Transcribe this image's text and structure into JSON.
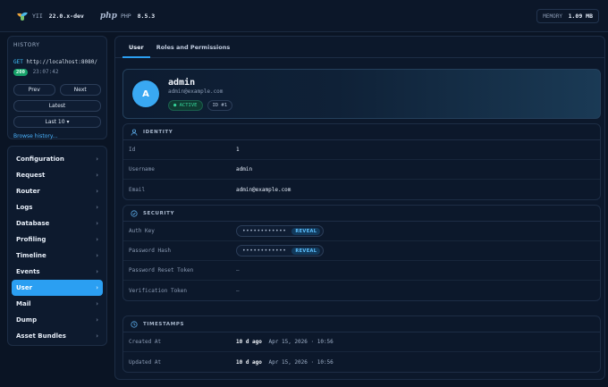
{
  "topbar": {
    "framework_label": "YII",
    "framework_version": "22.0.x-dev",
    "php_logo": "php",
    "php_label": "PHP",
    "php_version": "8.5.3",
    "memory_label": "MEMORY",
    "memory_value": "1.09 MB"
  },
  "history": {
    "title": "HISTORY",
    "method": "GET",
    "url": "http://localhost:8080/",
    "status": "200",
    "time": "23:07:42",
    "prev_label": "Prev",
    "next_label": "Next",
    "latest_label": "Latest",
    "last_label": "Last 10 ▾",
    "browse_label": "Browse history..."
  },
  "nav": {
    "items": [
      {
        "label": "Configuration"
      },
      {
        "label": "Request"
      },
      {
        "label": "Router"
      },
      {
        "label": "Logs"
      },
      {
        "label": "Database"
      },
      {
        "label": "Profiling"
      },
      {
        "label": "Timeline"
      },
      {
        "label": "Events"
      },
      {
        "label": "User",
        "active": true
      },
      {
        "label": "Mail"
      },
      {
        "label": "Dump"
      },
      {
        "label": "Asset Bundles"
      }
    ],
    "chevron": "›"
  },
  "tabs": [
    {
      "label": "User",
      "active": true
    },
    {
      "label": "Roles and Permissions"
    }
  ],
  "profile": {
    "initial": "A",
    "name": "admin",
    "email": "admin@example.com",
    "status_badge": "● ACTIVE",
    "id_badge": "ID #1"
  },
  "identity": {
    "title": "IDENTITY",
    "rows": [
      {
        "label": "Id",
        "value": "1"
      },
      {
        "label": "Username",
        "value": "admin"
      },
      {
        "label": "Email",
        "value": "admin@example.com"
      }
    ]
  },
  "security": {
    "title": "SECURITY",
    "auth_key_label": "Auth Key",
    "auth_key_mask": "••••••••••••",
    "password_hash_label": "Password Hash",
    "password_hash_mask": "••••••••••••",
    "reveal_label": "REVEAL",
    "reset_token_label": "Password Reset Token",
    "reset_token_value": "—",
    "verification_token_label": "Verification Token",
    "verification_token_value": "—"
  },
  "timestamps": {
    "title": "TIMESTAMPS",
    "rows": [
      {
        "label": "Created At",
        "ago": "10 d ago",
        "date": "Apr 15, 2026 · 10:56"
      },
      {
        "label": "Updated At",
        "ago": "10 d ago",
        "date": "Apr 15, 2026 · 10:56"
      }
    ]
  },
  "colors": {
    "accent": "#2b9ff2",
    "background": "#0a1424",
    "success": "#35d49a"
  },
  "icons": {
    "logo": "yii-logo-icon",
    "identity": "user-icon",
    "security": "shield-icon",
    "timestamps": "clock-icon",
    "nav_chevron": "chevron-right-icon"
  }
}
